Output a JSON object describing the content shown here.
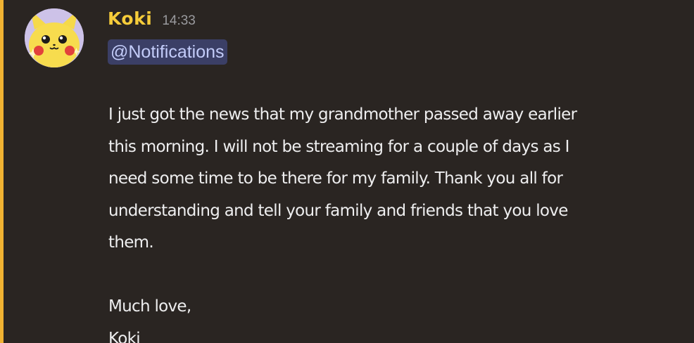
{
  "message": {
    "author": "Koki",
    "timestamp": "14:33",
    "mention": "@Notifications",
    "body_lines": [
      "I just got the news that my grandmother passed away earlier",
      "this morning. I will not be streaming for a couple of days as I",
      "need some time to be there for my family. Thank you all for",
      "understanding and tell your family and friends that you love",
      "them."
    ],
    "signoff": "Much love,",
    "signature": "Koki"
  },
  "avatar": {
    "icon": "pikachu-avatar-icon"
  },
  "colors": {
    "background": "#2a2522",
    "highlight_bar": "#f0b232",
    "username": "#f6cc3a",
    "mention_bg": "#3b3f66",
    "mention_text": "#c3ccf9",
    "text": "#eeeeef",
    "timestamp": "#9a9a9e"
  }
}
